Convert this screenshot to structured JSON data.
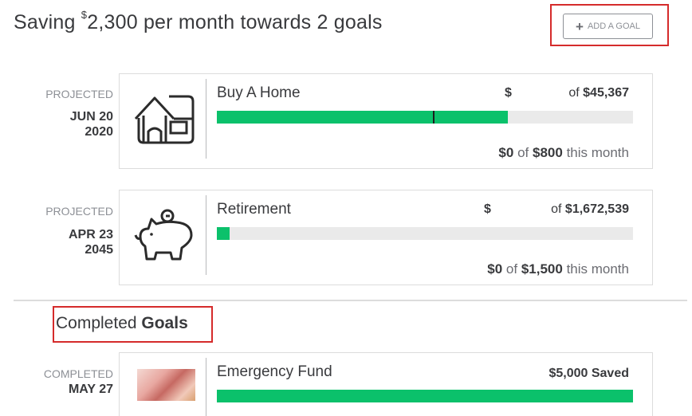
{
  "header": {
    "prefix": "Saving ",
    "currency": "$",
    "amount": "2,300",
    "suffix": " per month towards 2 goals",
    "add_goal_label": "ADD A GOAL"
  },
  "goals": [
    {
      "status_label": "PROJECTED",
      "date_line1": "JUN 20",
      "date_line2": "2020",
      "name": "Buy A Home",
      "icon": "house-icon",
      "dollar_sign": "$",
      "of_label": "of",
      "target": "$45,367",
      "progress": 0.7,
      "marker": 0.52,
      "month_saved": "$0",
      "month_of": "of",
      "month_target": "$800",
      "month_suffix": "this month"
    },
    {
      "status_label": "PROJECTED",
      "date_line1": "APR 23",
      "date_line2": "2045",
      "name": "Retirement",
      "icon": "piggy-bank-icon",
      "dollar_sign": "$",
      "of_label": "of",
      "target": "$1,672,539",
      "progress": 0.03,
      "month_saved": "$0",
      "month_of": "of",
      "month_target": "$1,500",
      "month_suffix": "this month"
    }
  ],
  "completed_section": {
    "title_plain": "Completed ",
    "title_bold": "Goals"
  },
  "completed_goals": [
    {
      "status_label": "COMPLETED",
      "date_line1": "MAY 27",
      "name": "Emergency Fund",
      "saved_label": "$5,000 Saved",
      "progress": 1.0
    }
  ],
  "colors": {
    "progress_green": "#0bc16b",
    "track_gray": "#eaeaea",
    "highlight_red": "#d52b2b"
  }
}
